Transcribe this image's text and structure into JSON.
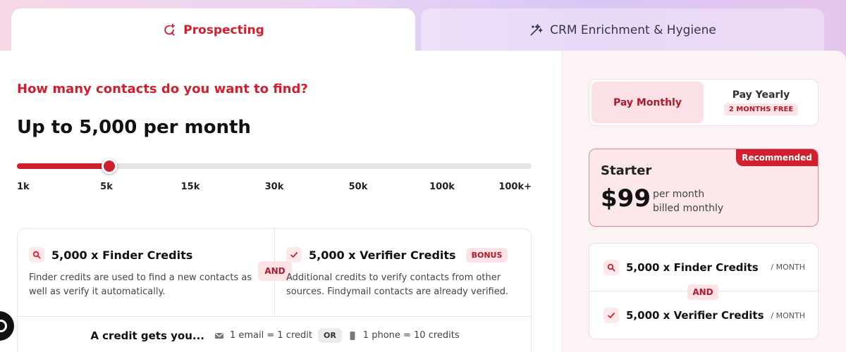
{
  "tabs": {
    "prospecting": "Prospecting",
    "crm": "CRM Enrichment & Hygiene"
  },
  "left": {
    "question": "How many contacts do you want to find?",
    "amount": "Up to 5,000 per month",
    "slider": {
      "value_index": 1,
      "ticks": [
        "1k",
        "5k",
        "15k",
        "30k",
        "50k",
        "100k",
        "100k+"
      ]
    },
    "finder": {
      "title": "5,000 x Finder Credits",
      "description": "Finder credits are used to find a new contacts as well as verify it automatically."
    },
    "and_label": "AND",
    "verifier": {
      "title": "5,000 x Verifier Credits",
      "bonus": "BONUS",
      "description": "Additional credits to verify contacts from other sources. Findymail contacts are already verified."
    },
    "credit_gets": {
      "label": "A credit gets you...",
      "email": "1 email = 1 credit",
      "or_label": "OR",
      "phone": "1 phone = 10 credits"
    }
  },
  "right": {
    "billing": {
      "monthly": "Pay Monthly",
      "yearly": "Pay Yearly",
      "yearly_badge": "2 MONTHS FREE"
    },
    "plan": {
      "badge": "Recommended",
      "name": "Starter",
      "price": "$99",
      "period_line1": "per month",
      "period_line2": "billed monthly"
    },
    "summary": {
      "finder": "5,000 x Finder Credits",
      "finder_unit": "/ MONTH",
      "and_label": "AND",
      "verifier": "5,000 x Verifier Credits",
      "verifier_unit": "/ MONTH"
    }
  },
  "colors": {
    "accent": "#d0202f",
    "accent_light": "#fde3e6"
  }
}
